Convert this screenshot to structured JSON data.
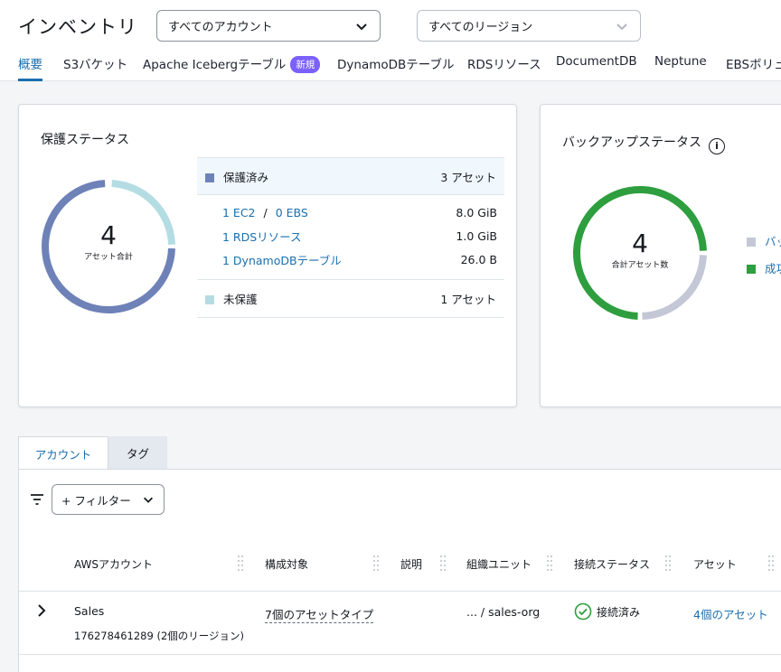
{
  "header": {
    "title": "インベントリ",
    "account_select": "すべてのアカウント",
    "region_select": "すべてのリージョン"
  },
  "tabs": [
    {
      "label": "概要",
      "active": true
    },
    {
      "label": "S3バケット"
    },
    {
      "label": "Apache Icebergテーブル",
      "badge": "新規"
    },
    {
      "label": "DynamoDBテーブル"
    },
    {
      "label": "RDSリソース"
    },
    {
      "label": "DocumentDB"
    },
    {
      "label": "Neptune"
    },
    {
      "label": "EBSボリュ"
    }
  ],
  "protection": {
    "title": "保護ステータス",
    "total": "4",
    "total_label": "アセット合計",
    "protected_label": "保護済み",
    "protected_count": "3 アセット",
    "rows": [
      {
        "a": "1 EC2",
        "sep": "/",
        "b": "0 EBS",
        "size": "8.0 GiB"
      },
      {
        "a": "1 RDSリソース",
        "size": "1.0 GiB"
      },
      {
        "a": "1 DynamoDBテーブル",
        "size": "26.0 B"
      }
    ],
    "unprotected_label": "未保護",
    "unprotected_count": "1 アセット",
    "protected_fraction": 0.75,
    "colors": {
      "protected": "#6e82b8",
      "unprotected": "#b4dde3"
    }
  },
  "backup": {
    "title": "バックアップステータス",
    "total": "4",
    "total_label": "合計アセット数",
    "legend": [
      "バッ",
      "成功"
    ],
    "success_fraction": 0.75,
    "colors": {
      "success": "#2e9e3e",
      "other": "#c3c7d6"
    }
  },
  "bottom_tabs": [
    "アカウント",
    "タグ"
  ],
  "filter": {
    "label": "+ フィルター"
  },
  "table": {
    "headers": [
      "AWSアカウント",
      "構成対象",
      "説明",
      "組織ユニット",
      "接続ステータス",
      "アセット"
    ],
    "rows": [
      {
        "name": "Sales",
        "id_line": "176278461289 (2個のリージョン)",
        "configured": "7個のアセットタイプ",
        "description": "",
        "org_unit": "... / sales-org",
        "status": "接続済み",
        "assets": "4個のアセット"
      }
    ]
  }
}
